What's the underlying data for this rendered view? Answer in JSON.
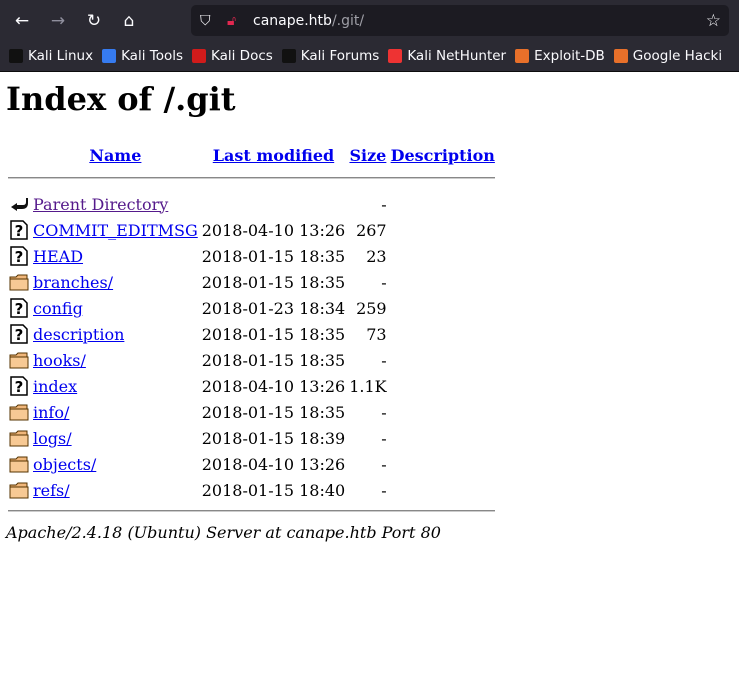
{
  "browser": {
    "url_host": "canape.htb",
    "url_path": "/.git/",
    "bookmarks": [
      {
        "label": "Kali Linux",
        "color": "#111"
      },
      {
        "label": "Kali Tools",
        "color": "#367bf0"
      },
      {
        "label": "Kali Docs",
        "color": "#d01b1b"
      },
      {
        "label": "Kali Forums",
        "color": "#111"
      },
      {
        "label": "Kali NetHunter",
        "color": "#e33"
      },
      {
        "label": "Exploit-DB",
        "color": "#e8702a"
      },
      {
        "label": "Google Hacki",
        "color": "#e8702a"
      }
    ]
  },
  "page": {
    "title": "Index of /.git",
    "columns": [
      "Name",
      "Last modified",
      "Size",
      "Description"
    ],
    "rows": [
      {
        "icon": "back",
        "name": "Parent Directory",
        "date": "",
        "size": "-"
      },
      {
        "icon": "unknown",
        "name": "COMMIT_EDITMSG",
        "date": "2018-04-10 13:26",
        "size": "267"
      },
      {
        "icon": "unknown",
        "name": "HEAD",
        "date": "2018-01-15 18:35",
        "size": "23"
      },
      {
        "icon": "folder",
        "name": "branches/",
        "date": "2018-01-15 18:35",
        "size": "-"
      },
      {
        "icon": "unknown",
        "name": "config",
        "date": "2018-01-23 18:34",
        "size": "259"
      },
      {
        "icon": "unknown",
        "name": "description",
        "date": "2018-01-15 18:35",
        "size": "73"
      },
      {
        "icon": "folder",
        "name": "hooks/",
        "date": "2018-01-15 18:35",
        "size": "-"
      },
      {
        "icon": "unknown",
        "name": "index",
        "date": "2018-04-10 13:26",
        "size": "1.1K"
      },
      {
        "icon": "folder",
        "name": "info/",
        "date": "2018-01-15 18:35",
        "size": "-"
      },
      {
        "icon": "folder",
        "name": "logs/",
        "date": "2018-01-15 18:39",
        "size": "-"
      },
      {
        "icon": "folder",
        "name": "objects/",
        "date": "2018-04-10 13:26",
        "size": "-"
      },
      {
        "icon": "folder",
        "name": "refs/",
        "date": "2018-01-15 18:40",
        "size": "-"
      }
    ],
    "footer": "Apache/2.4.18 (Ubuntu) Server at canape.htb Port 80"
  }
}
